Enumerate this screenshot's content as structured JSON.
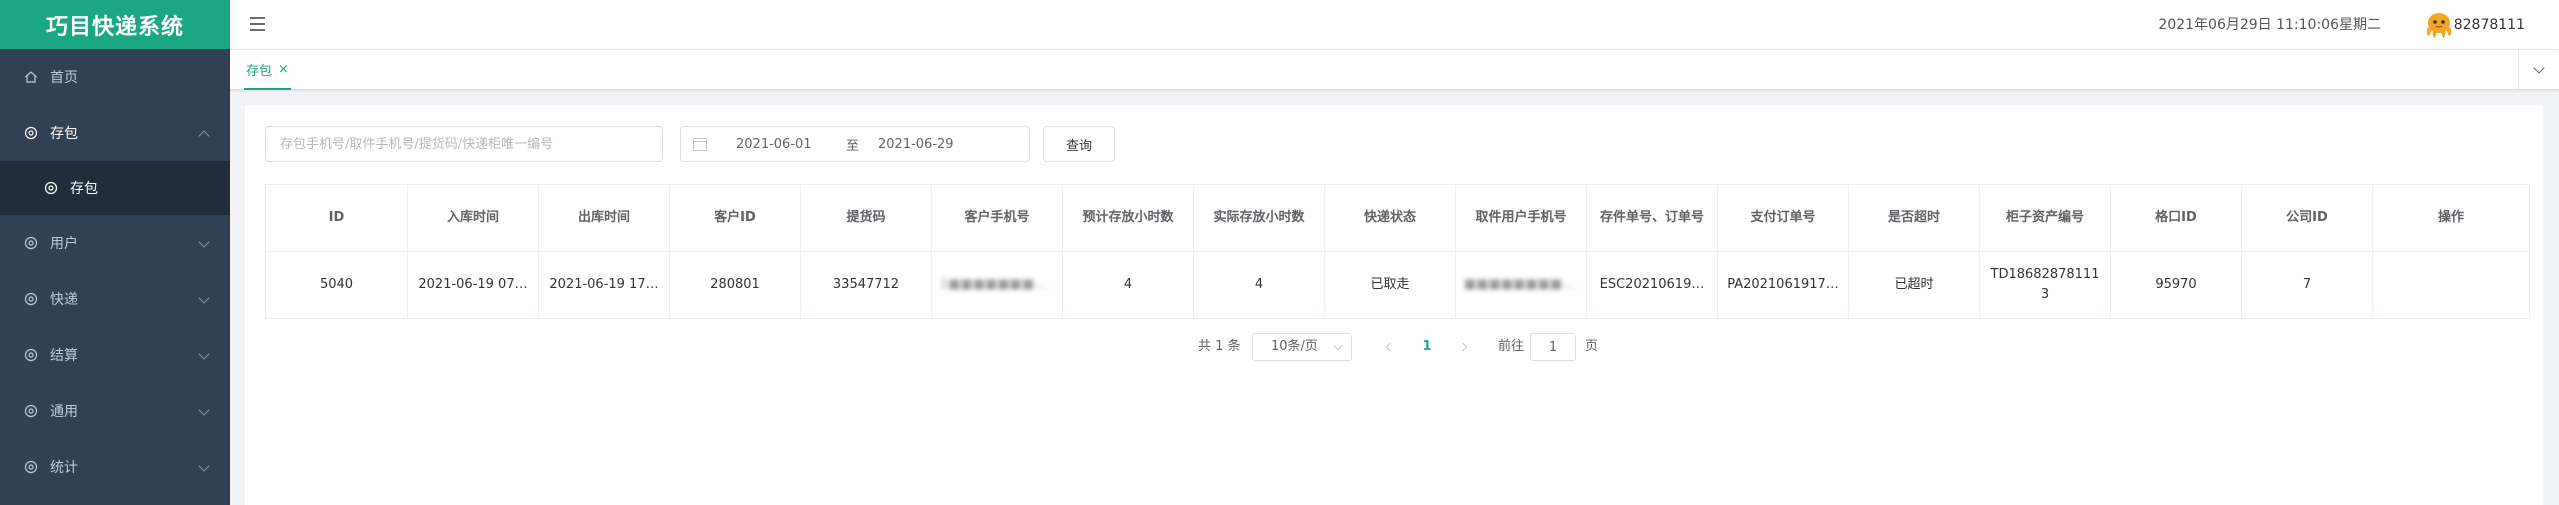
{
  "app": {
    "title": "巧目快递系统",
    "brand_color": "#1ba784",
    "sidebar_color": "#304156"
  },
  "sidebar": {
    "items": [
      {
        "label": "首页",
        "icon": "home-icon"
      },
      {
        "label": "存包",
        "icon": "gear-icon",
        "expanded": true,
        "children": [
          {
            "label": "存包",
            "icon": "gear-icon",
            "active": true
          }
        ]
      },
      {
        "label": "用户",
        "icon": "gear-icon"
      },
      {
        "label": "快递",
        "icon": "gear-icon"
      },
      {
        "label": "结算",
        "icon": "gear-icon"
      },
      {
        "label": "通用",
        "icon": "gear-icon"
      },
      {
        "label": "统计",
        "icon": "gear-icon"
      }
    ]
  },
  "header": {
    "datetime": "2021年06月29日 11:10:06星期二",
    "username": "82878111",
    "avatar_icon": "octopus-avatar-icon"
  },
  "tags": [
    {
      "label": "存包",
      "close": "×",
      "active": true
    }
  ],
  "search": {
    "placeholder": "存包手机号/取件手机号/提货码/快递柜唯一编号",
    "date_start": "2021-06-01",
    "date_sep": "至",
    "date_end": "2021-06-29",
    "query_label": "查询"
  },
  "table": {
    "headers": [
      "ID",
      "入库时间",
      "出库时间",
      "客户ID",
      "提货码",
      "客户手机号",
      "预计存放小时数",
      "实际存放小时数",
      "快递状态",
      "取件用户手机号",
      "存件单号、订单号",
      "支付订单号",
      "是否超时",
      "柜子资产编号",
      "格口ID",
      "公司ID",
      "操作"
    ],
    "rows": [
      [
        "5040",
        "2021-06-19 07…",
        "2021-06-19 17…",
        "280801",
        "33547712",
        "1■■■■■■■■■■",
        "4",
        "4",
        "已取走",
        "■■■■■■■■■■■",
        "ESC20210619…",
        "PA2021061917…",
        "已超时",
        "TD186828781113",
        "95970",
        "7",
        ""
      ]
    ]
  },
  "pagination": {
    "total": "共 1 条",
    "page_size": "10条/页",
    "current_page": "1",
    "goto_label": "前往",
    "goto_value": "1",
    "page_unit": "页"
  }
}
